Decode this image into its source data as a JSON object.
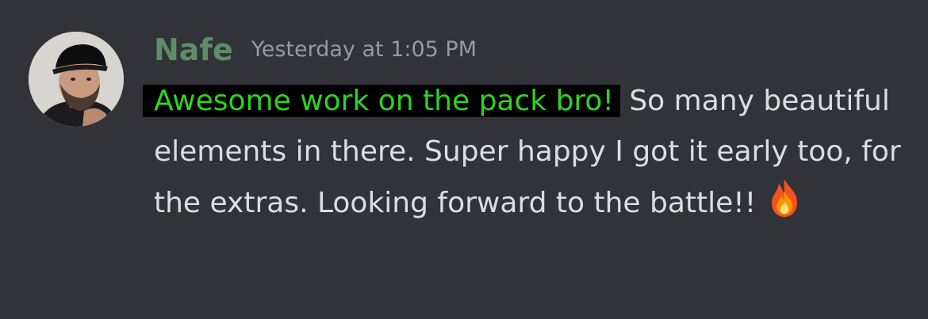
{
  "message": {
    "author": {
      "name": "Nafe",
      "name_color": "#5e8c66"
    },
    "timestamp": "Yesterday at 1:05 PM",
    "highlighted_text": "Awesome work on the pack bro!",
    "highlight_color": "#2cd51f",
    "body_text": " So many beautiful elements in there. Super happy I got it early too, for the extras. Looking forward to the battle!!",
    "emoji": "fire-emoji"
  },
  "theme": {
    "background": "#313338",
    "text": "#dbdee1",
    "muted": "#949ba4"
  }
}
